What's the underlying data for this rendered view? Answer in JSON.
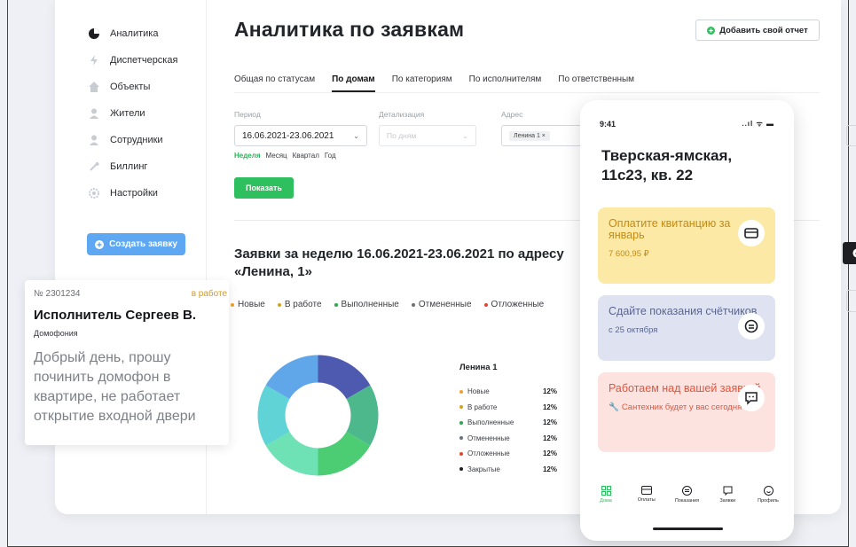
{
  "sidebar": {
    "items": [
      {
        "label": "Аналитика",
        "icon": "pie-chart-icon"
      },
      {
        "label": "Диспетчерская",
        "icon": "lightning-icon"
      },
      {
        "label": "Объекты",
        "icon": "house-icon"
      },
      {
        "label": "Жители",
        "icon": "person-icon"
      },
      {
        "label": "Сотрудники",
        "icon": "person-icon"
      },
      {
        "label": "Биллинг",
        "icon": "billing-icon"
      },
      {
        "label": "Настройки",
        "icon": "gear-icon"
      }
    ],
    "create_button": "Создать заявку"
  },
  "header": {
    "title": "Аналитика по заявкам",
    "add_report": "Добавить свой отчет"
  },
  "tabs": [
    "Общая по статусам",
    "По домам",
    "По категориям",
    "По исполнителям",
    "По ответственным"
  ],
  "filters": {
    "period_label": "Период",
    "period_value": "16.06.2021-23.06.2021",
    "detail_label": "Детализация",
    "detail_value": "По дням",
    "address_label": "Адрес",
    "address_chip": "Ленина 1 ×",
    "period_links": [
      "Неделя",
      "Месяц",
      "Квартал",
      "Год"
    ],
    "show_button": "Показать"
  },
  "chart_title": "Заявки за неделю 16.06.2021-23.06.2021 по адресу «Ленина, 1»",
  "legend": [
    {
      "label": "Новые",
      "color": "#f0a02b"
    },
    {
      "label": "В работе",
      "color": "#d6a316"
    },
    {
      "label": "Выполненные",
      "color": "#2ea44f"
    },
    {
      "label": "Отмененные",
      "color": "#6b7078"
    },
    {
      "label": "Отложенные",
      "color": "#e3442f"
    }
  ],
  "chart_data": {
    "type": "pie",
    "title": "Ленина 1",
    "categories": [
      "Новые",
      "В работе",
      "Выполненные",
      "Отмененные",
      "Отложенные",
      "Закрытые"
    ],
    "values": [
      12,
      12,
      12,
      12,
      12,
      12
    ],
    "value_labels": [
      "12%",
      "12%",
      "12%",
      "12%",
      "12%",
      "12%"
    ],
    "colors": [
      "#f0a02b",
      "#d6a316",
      "#2ea44f",
      "#6b7078",
      "#e3442f",
      "#1d1f23"
    ],
    "segment_colors": [
      "#4d5ab0",
      "#4cb88b",
      "#4ccd74",
      "#6ee2b5",
      "#5fd3d6",
      "#5fa7e8"
    ]
  },
  "ticket": {
    "number": "№ 2301234",
    "status": "в работе",
    "executor": "Исполнитель Сергеев В.",
    "category": "Домофония",
    "text": "Добрый день, прошу починить домофон в квартире, не работает открытие входной двери"
  },
  "phone": {
    "time": "9:41",
    "status_icons": "..ıl ᯤ ▬",
    "address": "Тверская-ямская, 11с23, кв. 22",
    "cards": [
      {
        "title": "Оплатите квитанцию за январь",
        "sub": "7 600,95 ₽",
        "icon": "wallet-icon",
        "bg": "#fde9a6",
        "color": "#c48a12"
      },
      {
        "title": "Сдайте показания счётчиков",
        "sub": "с 25 октября",
        "icon": "meter-icon",
        "bg": "#dfe3f1",
        "color": "#5b6690"
      },
      {
        "title": "Работаем над вашей заявкой",
        "sub": "Сантехник будет у вас сегодня",
        "icon": "chat-icon",
        "bg": "#fde3e0",
        "color": "#e0563f"
      }
    ],
    "nav": [
      "Дома",
      "Оплаты",
      "Показания",
      "Заявки",
      "Профиль"
    ]
  }
}
